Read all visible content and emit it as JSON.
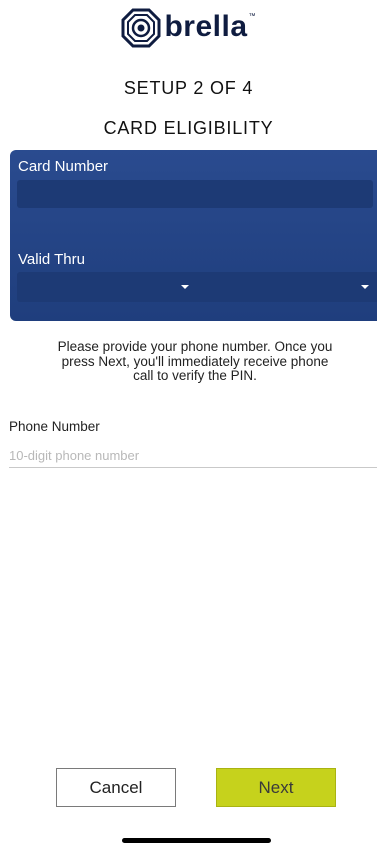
{
  "brand": {
    "name": "brella",
    "tm": "™"
  },
  "header": {
    "step": "SETUP 2 OF 4",
    "section": "CARD ELIGIBILITY"
  },
  "card": {
    "number_label": "Card Number",
    "number_value": "",
    "valid_thru_label": "Valid Thru",
    "month_value": "",
    "year_value": ""
  },
  "info": {
    "message": "Please provide your phone number. Once you press Next, you'll immediately receive phone call to verify the PIN."
  },
  "phone": {
    "label": "Phone Number",
    "placeholder": "10-digit phone number",
    "value": ""
  },
  "actions": {
    "cancel_label": "Cancel",
    "next_label": "Next"
  },
  "colors": {
    "brand": "#0f1c40",
    "card_panel": "#2a4b8f",
    "next_button": "#c6d21c"
  },
  "icons": {
    "logo": "brella-logo-icon",
    "dropdown": "chevron-down-icon"
  }
}
